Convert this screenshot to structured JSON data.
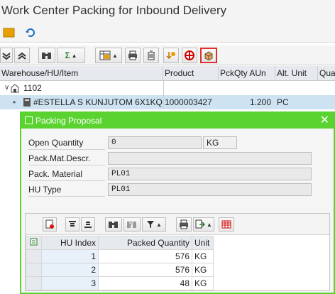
{
  "window": {
    "title": "Work Center Packing for Inbound Delivery"
  },
  "columns": [
    "Warehouse/HU/Item",
    "Product",
    "PckQty AUn",
    "Alt. Unit",
    "Qua"
  ],
  "tree": {
    "node": "1102",
    "item": {
      "label": "#ESTELLA S KUNJUTOM 6X1KQ",
      "product": "1000003427",
      "qty": "1.200",
      "unit": "PC"
    }
  },
  "dialog": {
    "title": "Packing Proposal",
    "fields": {
      "open_quantity_label": "Open Quantity",
      "open_quantity_value": "0",
      "open_quantity_unit": "KG",
      "pack_mat_descr_label": "Pack.Mat.Descr.",
      "pack_mat_descr_value": "",
      "pack_material_label": "Pack. Material",
      "pack_material_value": "PL01",
      "hu_type_label": "HU Type",
      "hu_type_value": "PL01"
    },
    "table": {
      "headers": {
        "index": "HU Index",
        "qty": "Packed Quantity",
        "unit": "Unit"
      },
      "rows": [
        {
          "index": "1",
          "qty": "576",
          "unit": "KG"
        },
        {
          "index": "2",
          "qty": "576",
          "unit": "KG"
        },
        {
          "index": "3",
          "qty": "48",
          "unit": "KG"
        }
      ]
    }
  },
  "colors": {
    "dialog_accent": "#5ad331",
    "selection": "#cde3f2"
  }
}
